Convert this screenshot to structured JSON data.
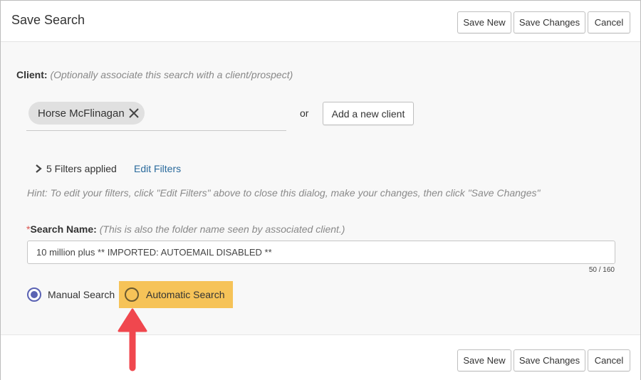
{
  "dialog": {
    "title": "Save Search",
    "buttons": {
      "save_new": "Save New",
      "save_changes": "Save Changes",
      "cancel": "Cancel"
    }
  },
  "client": {
    "label": "Client:",
    "hint": "(Optionally associate this search with a client/prospect)",
    "selected_chip": "Horse McFlinagan",
    "or_text": "or",
    "add_button": "Add a new client"
  },
  "filters": {
    "summary": "5 Filters applied",
    "edit_link": "Edit Filters",
    "hint": "Hint: To edit your filters, click \"Edit Filters\" above to close this dialog, make your changes, then click \"Save Changes\""
  },
  "search_name": {
    "required_mark": "*",
    "label": "Search Name:",
    "hint": "(This is also the folder name seen by associated client.)",
    "value": "10 million plus ** IMPORTED: AUTOEMAIL DISABLED **",
    "counter": "50 / 160"
  },
  "search_type": {
    "selected": "manual",
    "options": {
      "manual": "Manual Search",
      "automatic": "Automatic Search"
    }
  },
  "colors": {
    "highlight": "#f6c358",
    "radio_accent": "#5a62b3",
    "annotation_arrow": "#f0474e",
    "link": "#2a6a9c"
  },
  "icons": {
    "remove_chip": "close-icon",
    "filters_toggle": "chevron-right-icon",
    "annotation": "arrow-up-icon"
  }
}
